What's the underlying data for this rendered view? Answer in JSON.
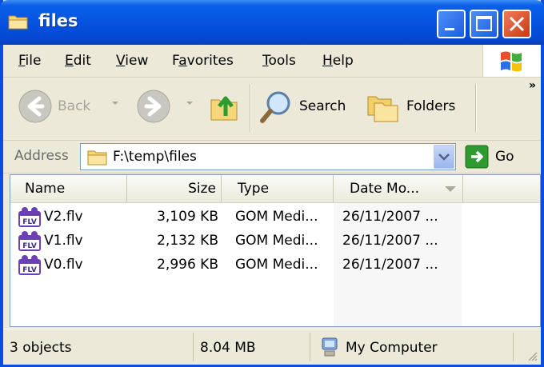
{
  "window": {
    "title": "files",
    "folder_icon": "folder-icon"
  },
  "menu": [
    {
      "label": "File",
      "accel": "F",
      "rest": "ile"
    },
    {
      "label": "Edit",
      "accel": "E",
      "rest": "dit"
    },
    {
      "label": "View",
      "accel": "V",
      "rest": "iew"
    },
    {
      "label": "Favorites",
      "accel": "a",
      "pre": "F",
      "rest": "vorites"
    },
    {
      "label": "Tools",
      "accel": "T",
      "rest": "ools"
    },
    {
      "label": "Help",
      "accel": "H",
      "rest": "elp"
    }
  ],
  "toolbar": {
    "back_label": "Back",
    "search_label": "Search",
    "folders_label": "Folders",
    "overflow": "»"
  },
  "address": {
    "label": "Address",
    "value": "F:\\temp\\files",
    "go_label": "Go"
  },
  "columns": [
    "Name",
    "Size",
    "Type",
    "Date Mo..."
  ],
  "files": [
    {
      "name": "V2.flv",
      "size": "3,109 KB",
      "type": "GOM Medi...",
      "date": "26/11/2007 ..."
    },
    {
      "name": "V1.flv",
      "size": "2,132 KB",
      "type": "GOM Medi...",
      "date": "26/11/2007 ..."
    },
    {
      "name": "V0.flv",
      "size": "2,996 KB",
      "type": "GOM Medi...",
      "date": "26/11/2007 ..."
    }
  ],
  "file_icon_label": "FLV",
  "status": {
    "objects": "3 objects",
    "size": "8.04 MB",
    "location": "My Computer"
  },
  "colors": {
    "titlebar": "#0553e0",
    "chrome": "#ece9d8",
    "close": "#c83a18",
    "go_green": "#2f9a2f"
  }
}
